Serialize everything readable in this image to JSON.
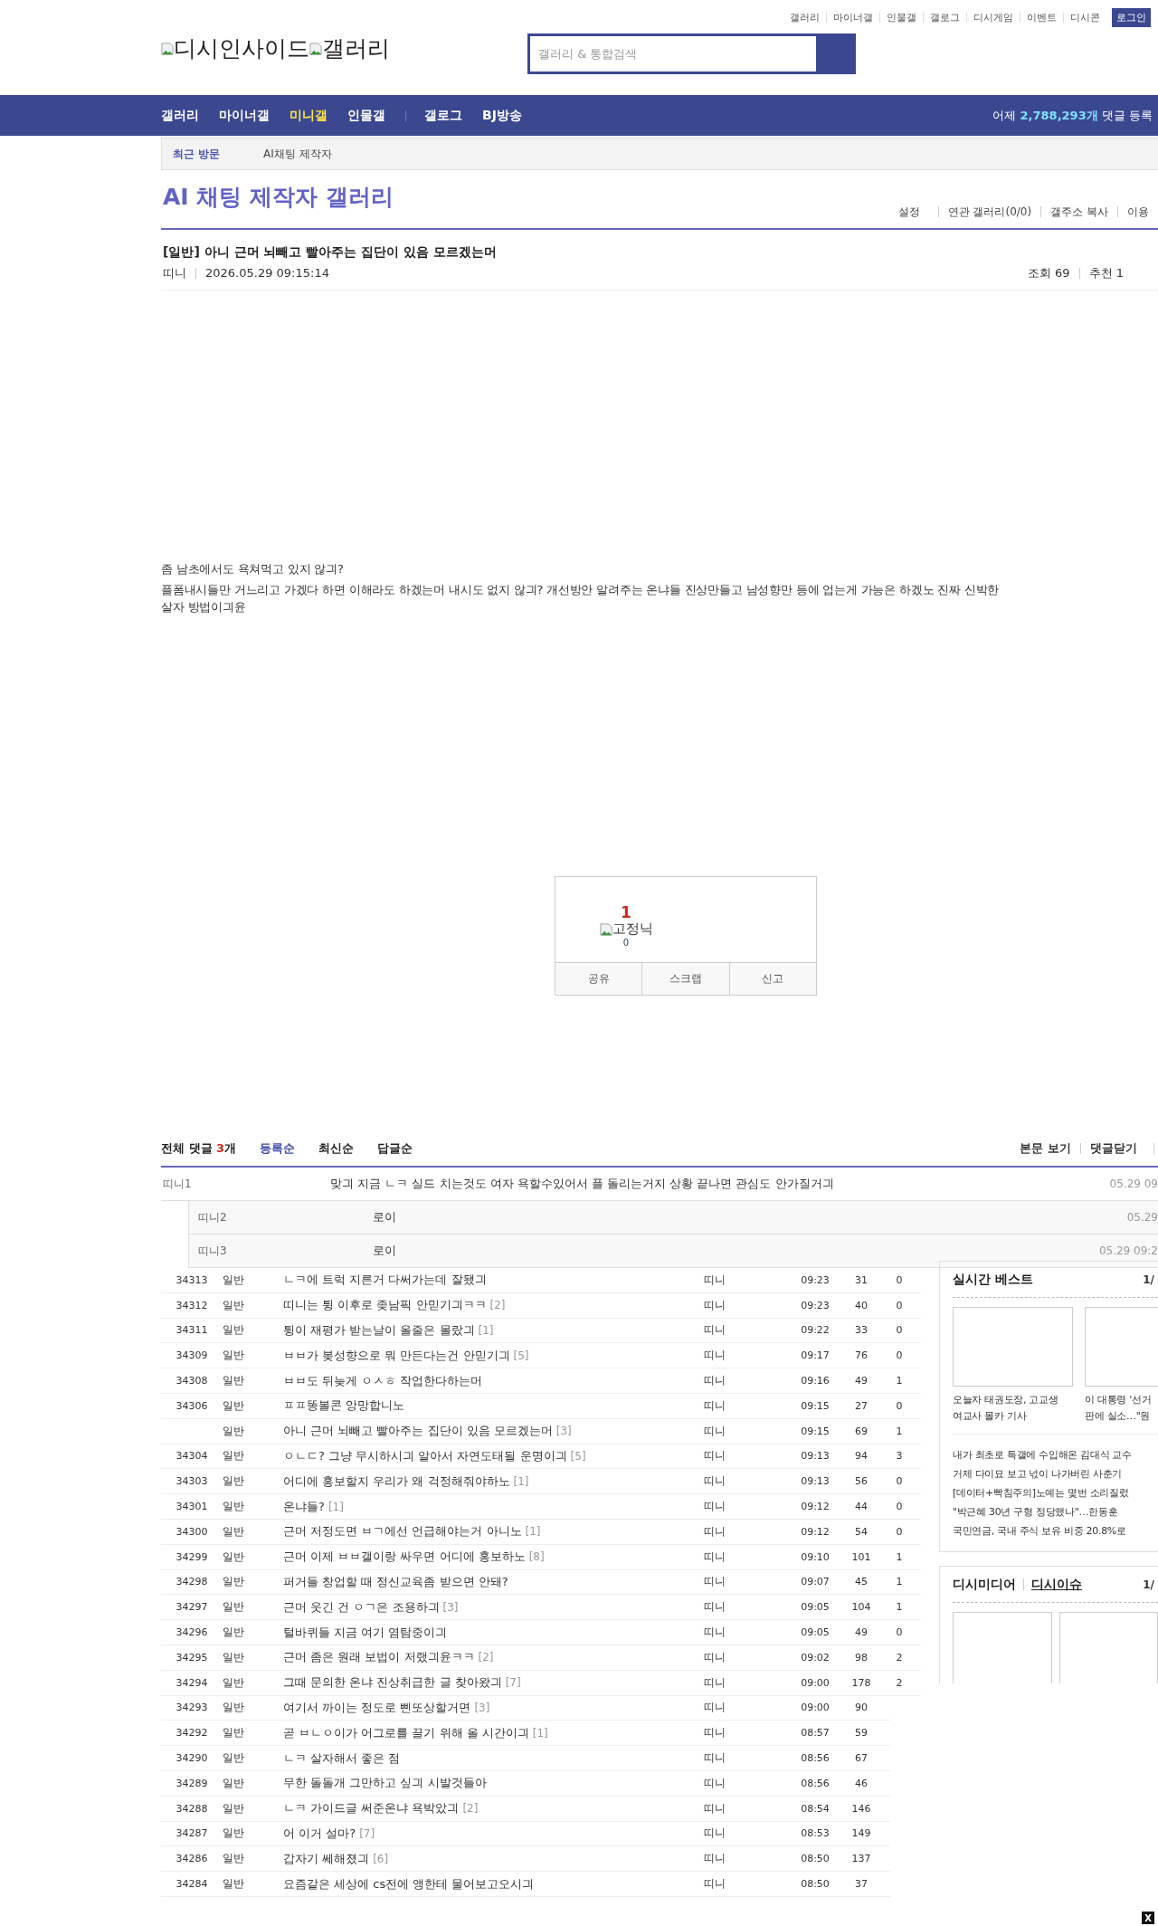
{
  "top_links": [
    "갤러리",
    "마이너갤",
    "인물갤",
    "갤로그",
    "디시게임",
    "이벤트",
    "디시콘"
  ],
  "login_button": "로그인",
  "logo": [
    "디시인사이드",
    "갤러리"
  ],
  "search": {
    "placeholder": "갤러리 & 통합검색"
  },
  "nav_groups": [
    [
      {
        "label": "갤러리",
        "selected": false
      },
      {
        "label": "마이너갤",
        "selected": false
      },
      {
        "label": "미니갤",
        "selected": true
      },
      {
        "label": "인물갤",
        "selected": false
      }
    ],
    [
      {
        "label": "갤로그",
        "selected": false
      },
      {
        "label": "BJ방송",
        "selected": false
      }
    ]
  ],
  "stats": {
    "prefix": "어제",
    "count": "2,788,293개",
    "suffix": "댓글 등록"
  },
  "recent": {
    "label": "최근 방문",
    "items": [
      "AI채팅 제작자"
    ]
  },
  "gallery": {
    "title": "AI 채팅 제작자 갤러리",
    "tools": [
      "설정",
      "연관 갤러리(0/0)",
      "갤주소 복사",
      "이용"
    ]
  },
  "post": {
    "title": "[일반] 아니 근머 뇌빼고 빨아주는 집단이 있음 모르겠는머",
    "author": "띠니",
    "date": "2026.05.29 09:15:14",
    "views": "조회 69",
    "recommend": "추천 1",
    "body": [
      "좀 남초에서도 욕쳐먹고 있지 않긔?",
      "플폼내시들만 거느리고 가겠다 하면 이해라도 하겠는머 내시도 없지 않긔? 개선방안 알려주는 온냐들 진상만들고 남성향만 등에 업는게 가능은 하겠노 진짜 신박한 살자 방법이긔윤"
    ]
  },
  "vote": {
    "count": "1",
    "image_alt": "고정닉",
    "sub_count": "0",
    "buttons": [
      "공유",
      "스크랩",
      "신고"
    ]
  },
  "comments": {
    "label": "전체 댓글",
    "count": "3",
    "unit": "개",
    "sorts": [
      {
        "label": "등록순",
        "selected": true
      },
      {
        "label": "최신순",
        "selected": false
      },
      {
        "label": "답글순",
        "selected": false
      }
    ],
    "actions": [
      "본문 보기",
      "댓글닫기"
    ],
    "items": [
      {
        "kind": "comment",
        "author": "띠니1",
        "text": "맞긔 지금 ㄴㅋ 실드 치는것도 여자 욕할수있어서 플 돌리는거지 상황 끝나면 관심도 안가질거긔",
        "date": "05.29 09"
      },
      {
        "kind": "reply",
        "author": "띠니2",
        "text": "로이",
        "date": "05.29"
      },
      {
        "kind": "reply",
        "author": "띠니3",
        "text": "로이",
        "date": "05.29 09:2"
      }
    ]
  },
  "posts": [
    {
      "num": "34313",
      "type": "일반",
      "title": "ㄴㅋ에 트럭 지른거 다써가는데 잘됐긔",
      "writer": "띠니",
      "time": "09:23",
      "views": "31",
      "recommend": "0"
    },
    {
      "num": "34312",
      "type": "일반",
      "title": "띠니는 튕 이후로 좆남픽 안믿기긔ㅋㅋ",
      "reply_count": "[2]",
      "writer": "띠니",
      "time": "09:23",
      "views": "40",
      "recommend": "0"
    },
    {
      "num": "34311",
      "type": "일반",
      "title": "튕이 재평가 받는날이 올줄은 몰랐긔",
      "reply_count": "[1]",
      "writer": "띠니",
      "time": "09:22",
      "views": "33",
      "recommend": "0"
    },
    {
      "num": "34309",
      "type": "일반",
      "title": "ㅂㅂ가 봊성향으로 뭐 만든다는건 안믿기긔",
      "reply_count": "[5]",
      "writer": "띠니",
      "time": "09:17",
      "views": "76",
      "recommend": "0"
    },
    {
      "num": "34308",
      "type": "일반",
      "title": "ㅂㅂ도 뒤늦게 ㅇㅅㅎ 작업한다하는머",
      "writer": "띠니",
      "time": "09:16",
      "views": "49",
      "recommend": "1"
    },
    {
      "num": "34306",
      "type": "일반",
      "title": "ㅍㅍ똥볼콘 앙망합니노",
      "writer": "띠니",
      "time": "09:15",
      "views": "27",
      "recommend": "0"
    },
    {
      "type": "일반",
      "title": "아니 근머 뇌빼고 빨아주는 집단이 있음 모르겠는머",
      "reply_count": "[3]",
      "writer": "띠니",
      "time": "09:15",
      "views": "69",
      "recommend": "1"
    },
    {
      "num": "34304",
      "type": "일반",
      "title": "ㅇㄴㄷ? 그냥 무시하시긔 알아서 자연도태될 운명이긔",
      "reply_count": "[5]",
      "writer": "띠니",
      "time": "09:13",
      "views": "94",
      "recommend": "3"
    },
    {
      "num": "34303",
      "type": "일반",
      "title": "어디에 홍보할지 우리가 왜 걱정해줘야하노",
      "reply_count": "[1]",
      "writer": "띠니",
      "time": "09:13",
      "views": "56",
      "recommend": "0"
    },
    {
      "num": "34301",
      "type": "일반",
      "title": "온냐들?",
      "reply_count": "[1]",
      "writer": "띠니",
      "time": "09:12",
      "views": "44",
      "recommend": "0"
    },
    {
      "num": "34300",
      "type": "일반",
      "title": "근머 저정도면 ㅂㄱ에선 언급해야는거 아니노",
      "reply_count": "[1]",
      "writer": "띠니",
      "time": "09:12",
      "views": "54",
      "recommend": "0"
    },
    {
      "num": "34299",
      "type": "일반",
      "title": "근머 이제 ㅂㅂ갤이랑 싸우면 어디에 홍보하노",
      "reply_count": "[8]",
      "writer": "띠니",
      "time": "09:10",
      "views": "101",
      "recommend": "1"
    },
    {
      "num": "34298",
      "type": "일반",
      "title": "퍼거들 창업할 때 정신교육좀 받으면 안돼?",
      "writer": "띠니",
      "time": "09:07",
      "views": "45",
      "recommend": "1"
    },
    {
      "num": "34297",
      "type": "일반",
      "title": "근머 웃긴 건 ㅇㄱ은 조용하긔",
      "reply_count": "[3]",
      "writer": "띠니",
      "time": "09:05",
      "views": "104",
      "recommend": "1"
    },
    {
      "num": "34296",
      "type": "일반",
      "title": "털바퀴들 지금 여기 염탐중이긔",
      "writer": "띠니",
      "time": "09:05",
      "views": "49",
      "recommend": "0"
    },
    {
      "num": "34295",
      "type": "일반",
      "title": "근머 좀은 원래 보법이 저랬긔윤ㅋㅋ",
      "reply_count": "[2]",
      "writer": "띠니",
      "time": "09:02",
      "views": "98",
      "recommend": "2"
    },
    {
      "num": "34294",
      "type": "일반",
      "title": "그때 문의한 온냐 진상취급한 글 찾아왔긔",
      "reply_count": "[7]",
      "writer": "띠니",
      "time": "09:00",
      "views": "178",
      "recommend": "2"
    },
    {
      "num": "34293",
      "type": "일반",
      "title": "여기서 까이는 정도로 삔또상할거면",
      "reply_count": "[3]",
      "writer": "띠니",
      "time": "09:00",
      "views": "90"
    },
    {
      "num": "34292",
      "type": "일반",
      "title": "곧 ㅂㄴㅇ이가 어그로를 끌기 위해 올 시간이긔",
      "reply_count": "[1]",
      "writer": "띠니",
      "time": "08:57",
      "views": "59"
    },
    {
      "num": "34290",
      "type": "일반",
      "title": "ㄴㅋ 살자해서 좋은 점",
      "writer": "띠니",
      "time": "08:56",
      "views": "67"
    },
    {
      "num": "34289",
      "type": "일반",
      "title": "무한 돌돌개 그만하고 싶긔 시발것들아",
      "writer": "띠니",
      "time": "08:56",
      "views": "46"
    },
    {
      "num": "34288",
      "type": "일반",
      "title": "ㄴㅋ 가이드글 써준온냐 욕박았긔",
      "reply_count": "[2]",
      "writer": "띠니",
      "time": "08:54",
      "views": "146"
    },
    {
      "num": "34287",
      "type": "일반",
      "title": "어 이거 설마?",
      "reply_count": "[7]",
      "writer": "띠니",
      "time": "08:53",
      "views": "149"
    },
    {
      "num": "34286",
      "type": "일반",
      "title": "갑자기 쎄해졌긔",
      "reply_count": "[6]",
      "writer": "띠니",
      "time": "08:50",
      "views": "137"
    },
    {
      "num": "34284",
      "type": "일반",
      "title": "요즘같은 세상에 cs전에 앵한테 물어보고오시긔",
      "writer": "띠니",
      "time": "08:50",
      "views": "37"
    }
  ],
  "sidebar": {
    "best": {
      "title": "실시간 베스트",
      "page": "1/",
      "cards": [
        [
          "오늘자 태권도장, 고교생",
          "여교사 몰카 기사"
        ],
        [
          "이 대통령 '선거",
          "판에 실소…\"원"
        ]
      ],
      "links": [
        "내가 최초로 특갤에 수입해온 김대식 교수",
        "거제 다이묘 보고 넋이 나가버린 사춘기",
        "[데이터+빡침주의]노예는 몇번 소리질렀",
        "\"박근혜 30년 구형 정당했나\"…한동훈",
        "국민연금, 국내 주식 보유 비중 20.8%로"
      ]
    },
    "media": {
      "tabs": [
        {
          "label": "디시미디어",
          "selected": false
        },
        {
          "label": "디시이슈",
          "selected": true
        }
      ],
      "page": "1/"
    }
  },
  "close_button": "X"
}
